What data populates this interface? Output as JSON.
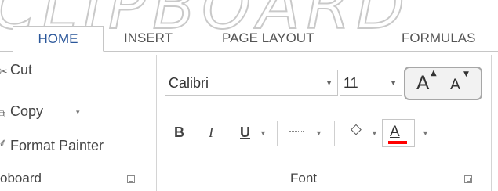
{
  "watermark": "CLIPBOARD",
  "tabs": [
    {
      "label": "HOME",
      "active": true
    },
    {
      "label": "INSERT",
      "active": false
    },
    {
      "label": "PAGE LAYOUT",
      "active": false
    },
    {
      "label": "FORMULAS",
      "active": false
    }
  ],
  "clipboard": {
    "cut_label": "Cut",
    "copy_label": "Copy",
    "copy_dropdown_glyph": "▾",
    "format_painter_label": "Format Painter",
    "group_label": "oboard"
  },
  "font": {
    "font_name": "Calibri",
    "font_size": "11",
    "grow_label": "A",
    "shrink_label": "A",
    "bold_label": "B",
    "italic_label": "I",
    "underline_label": "U",
    "font_color_label": "A",
    "group_label": "Font",
    "highlight_color": "#ffff00",
    "font_color": "#ff0000",
    "grow_shrink_highlight": "#a7a7a7"
  },
  "icons": {
    "cut": "scissors-icon",
    "copy": "copy-icon",
    "format_painter": "paintbrush-icon",
    "borders": "borders-icon",
    "fill": "fill-bucket-icon"
  }
}
